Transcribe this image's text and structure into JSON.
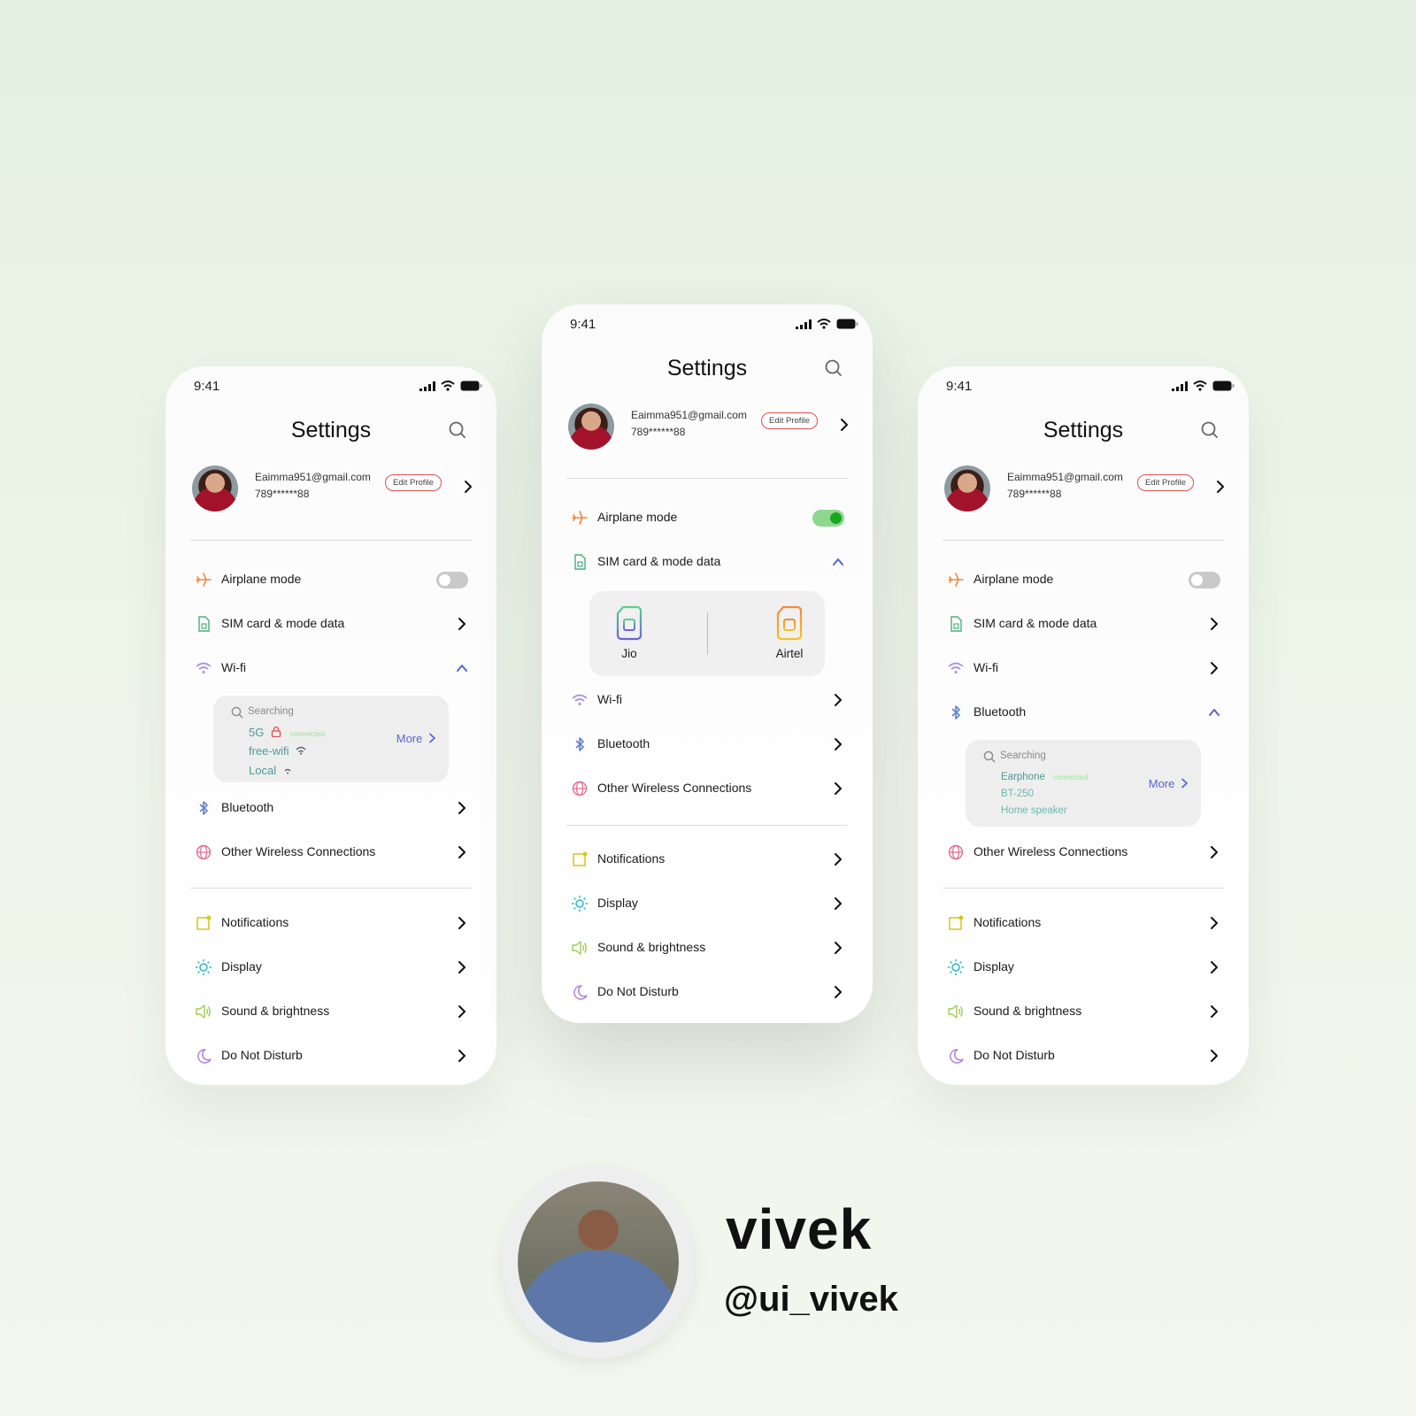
{
  "colors": {
    "accent_blue": "#5864d6",
    "edit_red": "#e24b4b",
    "toggle_on": "#18a81e",
    "teal_text": "#4a9b96",
    "connected_green": "#9be39a"
  },
  "status": {
    "time": "9:41"
  },
  "screen": {
    "title": "Settings",
    "profile": {
      "email": "Eaimma951@gmail.com",
      "phone": "789******88",
      "edit_label": "Edit Profile"
    },
    "items": {
      "airplane": "Airplane mode",
      "sim": "SIM card & mode data",
      "wifi": "Wi-fi",
      "bluetooth": "Bluetooth",
      "other": "Other Wireless Connections",
      "notifications": "Notifications",
      "display": "Display",
      "sound": "Sound & brightness",
      "dnd": "Do Not Disturb"
    }
  },
  "left_phone": {
    "airplane_on": false,
    "wifi_panel": {
      "searching": "Searching",
      "networks": [
        "5G",
        "free-wifi",
        "Local"
      ],
      "connected_label": "connected",
      "more": "More"
    }
  },
  "center_phone": {
    "airplane_on": true,
    "sims": [
      "Jio",
      "Airtel"
    ]
  },
  "right_phone": {
    "airplane_on": false,
    "bt_panel": {
      "searching": "Searching",
      "devices": [
        "Earphone",
        "BT-250",
        "Home speaker"
      ],
      "connected_label": "connected",
      "more": "More"
    }
  },
  "author": {
    "name": "vivek",
    "handle": "@ui_vivek"
  }
}
